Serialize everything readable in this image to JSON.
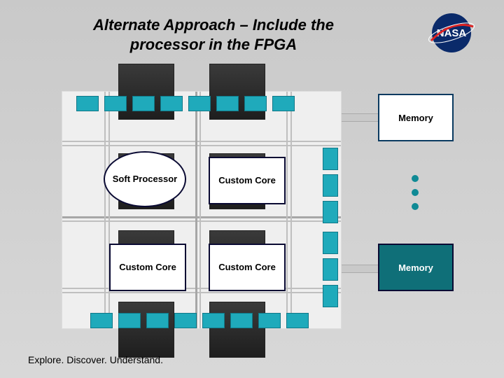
{
  "title": "Alternate Approach – Include the processor in the FPGA",
  "footer": "Explore. Discover. Understand.",
  "logo_alt": "NASA",
  "blocks": {
    "soft_processor": "Soft Processor",
    "custom_core_tr": "Custom Core",
    "custom_core_bl": "Custom Core",
    "custom_core_br": "Custom Core"
  },
  "memory": {
    "top": "Memory",
    "bottom": "Memory"
  },
  "colors": {
    "teal": "#1faabb",
    "dark_teal": "#0f6f78",
    "logic_block": "#2a2a2a"
  }
}
